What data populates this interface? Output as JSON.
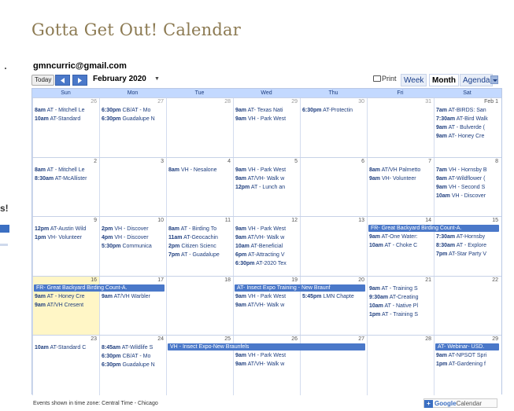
{
  "title": "Gotta Get Out! Calendar",
  "left_fragment": {
    "text": "s!"
  },
  "account": "gmncurric@gmail.com",
  "toolbar": {
    "today": "Today",
    "month": "February 2020",
    "print": "Print",
    "views": [
      "Week",
      "Month",
      "Agenda"
    ]
  },
  "days_of_week": [
    "Sun",
    "Mon",
    "Tue",
    "Wed",
    "Thu",
    "Fri",
    "Sat"
  ],
  "weeks": [
    {
      "dates": [
        "26",
        "27",
        "28",
        "29",
        "30",
        "31",
        "Feb 1"
      ],
      "events": [
        [
          {
            "t": "8am",
            "x": "AT - Mitchell Le"
          },
          {
            "t": "10am",
            "x": "AT-Standard"
          }
        ],
        [
          {
            "t": "6:30pm",
            "x": "CB/AT - Mo"
          },
          {
            "t": "6:30pm",
            "x": "Guadalupe N"
          }
        ],
        [],
        [
          {
            "t": "9am",
            "x": "AT- Texas Nati"
          },
          {
            "t": "9am",
            "x": "VH - Park West"
          }
        ],
        [
          {
            "t": "6:30pm",
            "x": "AT-Protectin"
          }
        ],
        [],
        [
          {
            "t": "7am",
            "x": "AT-BIRDS: San"
          },
          {
            "t": "7:30am",
            "x": "AT-Bird Walk"
          },
          {
            "t": "9am",
            "x": "AT - Bulverde ("
          },
          {
            "t": "9am",
            "x": "AT- Honey Cre"
          }
        ]
      ]
    },
    {
      "dates": [
        "2",
        "3",
        "4",
        "5",
        "6",
        "7",
        "8"
      ],
      "events": [
        [
          {
            "t": "8am",
            "x": "AT - Mitchell Le"
          },
          {
            "t": "8:30am",
            "x": "AT-McAllister"
          }
        ],
        [],
        [
          {
            "t": "8am",
            "x": "VH - Nesalone"
          }
        ],
        [
          {
            "t": "9am",
            "x": "VH - Park West"
          },
          {
            "t": "9am",
            "x": "AT/VH- Walk w"
          },
          {
            "t": "12pm",
            "x": "AT - Lunch an"
          }
        ],
        [],
        [
          {
            "t": "8am",
            "x": "AT/VH Palmetto"
          },
          {
            "t": "9am",
            "x": "VH- Volunteer"
          }
        ],
        [
          {
            "t": "7am",
            "x": "VH - Hornsby B"
          },
          {
            "t": "9am",
            "x": "AT-Wildflower ("
          },
          {
            "t": "9am",
            "x": "VH - Second S"
          },
          {
            "t": "10am",
            "x": "VH - Discover"
          }
        ]
      ]
    },
    {
      "dates": [
        "9",
        "10",
        "11",
        "12",
        "13",
        "14",
        "15"
      ],
      "bars": [
        {
          "text": "FR- Great Backyard Birding Count-A.",
          "start": 5,
          "span": 2
        }
      ],
      "events": [
        [
          {
            "t": "12pm",
            "x": "AT-Austin Wild"
          },
          {
            "t": "1pm",
            "x": "VH- Volunteer"
          }
        ],
        [
          {
            "t": "2pm",
            "x": "VH - Discover"
          },
          {
            "t": "4pm",
            "x": "VH - Discover"
          },
          {
            "t": "5:30pm",
            "x": "Communica"
          }
        ],
        [
          {
            "t": "8am",
            "x": "AT - Birding To"
          },
          {
            "t": "11am",
            "x": "AT-Geocachin"
          },
          {
            "t": "2pm",
            "x": "Citizen Scienc"
          },
          {
            "t": "7pm",
            "x": "AT - Guadalupe"
          }
        ],
        [
          {
            "t": "9am",
            "x": "VH - Park West"
          },
          {
            "t": "9am",
            "x": "AT/VH- Walk w"
          },
          {
            "t": "10am",
            "x": "AT-Beneficial"
          },
          {
            "t": "6pm",
            "x": "AT-Attracting V"
          },
          {
            "t": "6:30pm",
            "x": "AT-2020 Tex"
          }
        ],
        [],
        [
          {
            "t": "9am",
            "x": "AT-One Water:"
          },
          {
            "t": "10am",
            "x": "AT - Choke C"
          }
        ],
        [
          {
            "t": "7:30am",
            "x": "AT-Hornsby"
          },
          {
            "t": "8:30am",
            "x": "AT - Explore"
          },
          {
            "t": "7pm",
            "x": "AT-Star Party V"
          }
        ]
      ]
    },
    {
      "dates": [
        "16",
        "17",
        "18",
        "19",
        "20",
        "21",
        "22"
      ],
      "bars": [
        {
          "text": "FR- Great Backyard Birding Count-A.",
          "start": 0,
          "span": 2
        },
        {
          "text": "AT- Insect Expo Training - New Braunf",
          "start": 3,
          "span": 2
        }
      ],
      "events": [
        [
          {
            "t": "9am",
            "x": "AT - Honey Cre"
          },
          {
            "t": "9am",
            "x": "AT/VH Cresent"
          }
        ],
        [
          {
            "t": "9am",
            "x": "AT/VH Warbler"
          }
        ],
        [],
        [
          {
            "t": "9am",
            "x": "VH - Park West"
          },
          {
            "t": "9am",
            "x": "AT/VH- Walk w"
          }
        ],
        [
          {
            "t": "5:45pm",
            "x": "LMN Chapte"
          }
        ],
        [
          {
            "t": "9am",
            "x": "AT - Training S"
          },
          {
            "t": "9:30am",
            "x": "AT-Creating"
          },
          {
            "t": "10am",
            "x": "AT - Native Pl"
          },
          {
            "t": "1pm",
            "x": "AT - Training S"
          }
        ],
        []
      ]
    },
    {
      "dates": [
        "23",
        "24",
        "25",
        "26",
        "27",
        "28",
        "29"
      ],
      "bars": [
        {
          "text": "VH - Insect Expo-New Braunfels",
          "start": 2,
          "span": 3
        },
        {
          "text": "AT- Webinar- USD.",
          "start": 6,
          "span": 1
        }
      ],
      "events": [
        [
          {
            "t": "10am",
            "x": "AT-Standard C"
          }
        ],
        [
          {
            "t": "8:45am",
            "x": "AT-Wildlife S"
          },
          {
            "t": "6:30pm",
            "x": "CB/AT - Mo"
          },
          {
            "t": "6:30pm",
            "x": "Guadalupe N"
          }
        ],
        [],
        [
          {
            "t": "9am",
            "x": "VH - Park West"
          },
          {
            "t": "9am",
            "x": "AT/VH- Walk w"
          }
        ],
        [],
        [],
        [
          {
            "t": "9am",
            "x": "AT-NPSOT Spri"
          },
          {
            "t": "1pm",
            "x": "AT-Gardening f"
          }
        ]
      ]
    }
  ],
  "footer": {
    "timezone": "Events shown in time zone: Central Time - Chicago",
    "badge_google": "Google",
    "badge_calendar": "Calendar"
  },
  "colors": {
    "accent": "#4a78c9",
    "header_bg": "#c3d9ff",
    "today_bg": "#fff6c6",
    "title": "#8c7a52"
  }
}
